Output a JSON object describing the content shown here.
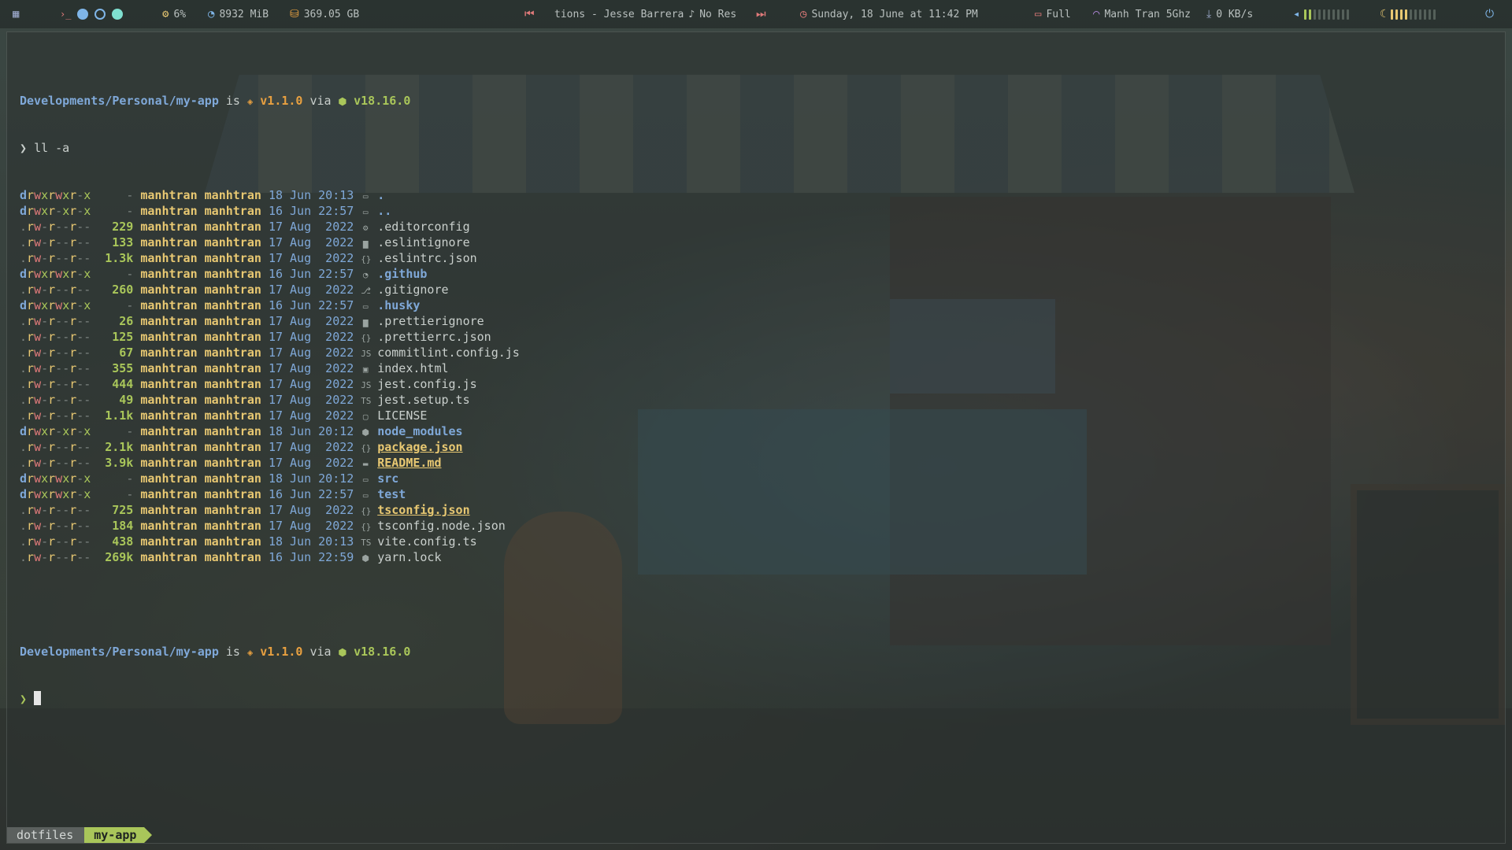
{
  "topbar": {
    "cpu": "6%",
    "mem": "8932 MiB",
    "disk": "369.05 GB",
    "track": "tions - Jesse Barrera",
    "note_glyph": "♪",
    "resolution": "No Res",
    "datetime": "Sunday, 18 June at 11:42 PM",
    "battery": "Full",
    "wifi": "Manh Tran 5Ghz",
    "net": "0 KB/s",
    "ws_colors": [
      "#e07a7a",
      "#7fb5e8",
      "#7fb5e8",
      "#7fe0d0"
    ],
    "accent": "#e8c872"
  },
  "terminal": {
    "prompt_path": "Developments/Personal/my-app",
    "is": "is",
    "pkg_icon": "📦",
    "version": "v1.1.0",
    "via": "via",
    "node_icon": "⬢",
    "node_version": "v18.16.0",
    "prompt_char": "❯",
    "command": "ll -a",
    "files": [
      {
        "perm": "drwxrwxr-x",
        "size": "-",
        "user": "manhtran",
        "group": "manhtran",
        "day": "18",
        "mon": "Jun",
        "time": "20:13",
        "icon": "▭",
        "name": ".",
        "kind": "dir"
      },
      {
        "perm": "drwxr-xr-x",
        "size": "-",
        "user": "manhtran",
        "group": "manhtran",
        "day": "16",
        "mon": "Jun",
        "time": "22:57",
        "icon": "▭",
        "name": "..",
        "kind": "dir"
      },
      {
        "perm": ".rw-r--r--",
        "size": "229",
        "user": "manhtran",
        "group": "manhtran",
        "day": "17",
        "mon": "Aug",
        "time": " 2022",
        "icon": "⚙",
        "name": ".editorconfig",
        "kind": "file"
      },
      {
        "perm": ".rw-r--r--",
        "size": "133",
        "user": "manhtran",
        "group": "manhtran",
        "day": "17",
        "mon": "Aug",
        "time": " 2022",
        "icon": "▆",
        "name": ".eslintignore",
        "kind": "file"
      },
      {
        "perm": ".rw-r--r--",
        "size": "1.3k",
        "user": "manhtran",
        "group": "manhtran",
        "day": "17",
        "mon": "Aug",
        "time": " 2022",
        "icon": "{}",
        "name": ".eslintrc.json",
        "kind": "file"
      },
      {
        "perm": "drwxrwxr-x",
        "size": "-",
        "user": "manhtran",
        "group": "manhtran",
        "day": "16",
        "mon": "Jun",
        "time": "22:57",
        "icon": "◔",
        "name": ".github",
        "kind": "dir"
      },
      {
        "perm": ".rw-r--r--",
        "size": "260",
        "user": "manhtran",
        "group": "manhtran",
        "day": "17",
        "mon": "Aug",
        "time": " 2022",
        "icon": "⎇",
        "name": ".gitignore",
        "kind": "file"
      },
      {
        "perm": "drwxrwxr-x",
        "size": "-",
        "user": "manhtran",
        "group": "manhtran",
        "day": "16",
        "mon": "Jun",
        "time": "22:57",
        "icon": "▭",
        "name": ".husky",
        "kind": "dir"
      },
      {
        "perm": ".rw-r--r--",
        "size": "26",
        "user": "manhtran",
        "group": "manhtran",
        "day": "17",
        "mon": "Aug",
        "time": " 2022",
        "icon": "▆",
        "name": ".prettierignore",
        "kind": "file"
      },
      {
        "perm": ".rw-r--r--",
        "size": "125",
        "user": "manhtran",
        "group": "manhtran",
        "day": "17",
        "mon": "Aug",
        "time": " 2022",
        "icon": "{}",
        "name": ".prettierrc.json",
        "kind": "file"
      },
      {
        "perm": ".rw-r--r--",
        "size": "67",
        "user": "manhtran",
        "group": "manhtran",
        "day": "17",
        "mon": "Aug",
        "time": " 2022",
        "icon": "JS",
        "name": "commitlint.config.js",
        "kind": "file"
      },
      {
        "perm": ".rw-r--r--",
        "size": "355",
        "user": "manhtran",
        "group": "manhtran",
        "day": "17",
        "mon": "Aug",
        "time": " 2022",
        "icon": "▣",
        "name": "index.html",
        "kind": "file"
      },
      {
        "perm": ".rw-r--r--",
        "size": "444",
        "user": "manhtran",
        "group": "manhtran",
        "day": "17",
        "mon": "Aug",
        "time": " 2022",
        "icon": "JS",
        "name": "jest.config.js",
        "kind": "file"
      },
      {
        "perm": ".rw-r--r--",
        "size": "49",
        "user": "manhtran",
        "group": "manhtran",
        "day": "17",
        "mon": "Aug",
        "time": " 2022",
        "icon": "TS",
        "name": "jest.setup.ts",
        "kind": "file"
      },
      {
        "perm": ".rw-r--r--",
        "size": "1.1k",
        "user": "manhtran",
        "group": "manhtran",
        "day": "17",
        "mon": "Aug",
        "time": " 2022",
        "icon": "▢",
        "name": "LICENSE",
        "kind": "file"
      },
      {
        "perm": "drwxr-xr-x",
        "size": "-",
        "user": "manhtran",
        "group": "manhtran",
        "day": "18",
        "mon": "Jun",
        "time": "20:12",
        "icon": "⬢",
        "name": "node_modules",
        "kind": "dir"
      },
      {
        "perm": ".rw-r--r--",
        "size": "2.1k",
        "user": "manhtran",
        "group": "manhtran",
        "day": "17",
        "mon": "Aug",
        "time": " 2022",
        "icon": "{}",
        "name": "package.json",
        "kind": "hl"
      },
      {
        "perm": ".rw-r--r--",
        "size": "3.9k",
        "user": "manhtran",
        "group": "manhtran",
        "day": "17",
        "mon": "Aug",
        "time": " 2022",
        "icon": "▬",
        "name": "README.md",
        "kind": "hl"
      },
      {
        "perm": "drwxrwxr-x",
        "size": "-",
        "user": "manhtran",
        "group": "manhtran",
        "day": "18",
        "mon": "Jun",
        "time": "20:12",
        "icon": "▭",
        "name": "src",
        "kind": "dir"
      },
      {
        "perm": "drwxrwxr-x",
        "size": "-",
        "user": "manhtran",
        "group": "manhtran",
        "day": "16",
        "mon": "Jun",
        "time": "22:57",
        "icon": "▭",
        "name": "test",
        "kind": "dir"
      },
      {
        "perm": ".rw-r--r--",
        "size": "725",
        "user": "manhtran",
        "group": "manhtran",
        "day": "17",
        "mon": "Aug",
        "time": " 2022",
        "icon": "{}",
        "name": "tsconfig.json",
        "kind": "hl"
      },
      {
        "perm": ".rw-r--r--",
        "size": "184",
        "user": "manhtran",
        "group": "manhtran",
        "day": "17",
        "mon": "Aug",
        "time": " 2022",
        "icon": "{}",
        "name": "tsconfig.node.json",
        "kind": "file"
      },
      {
        "perm": ".rw-r--r--",
        "size": "438",
        "user": "manhtran",
        "group": "manhtran",
        "day": "18",
        "mon": "Jun",
        "time": "20:13",
        "icon": "TS",
        "name": "vite.config.ts",
        "kind": "file"
      },
      {
        "perm": ".rw-r--r--",
        "size": "269k",
        "user": "manhtran",
        "group": "manhtran",
        "day": "16",
        "mon": "Jun",
        "time": "22:59",
        "icon": "⬢",
        "name": "yarn.lock",
        "kind": "file"
      }
    ]
  },
  "status_bar": {
    "session": "dotfiles",
    "window": "my-app"
  }
}
